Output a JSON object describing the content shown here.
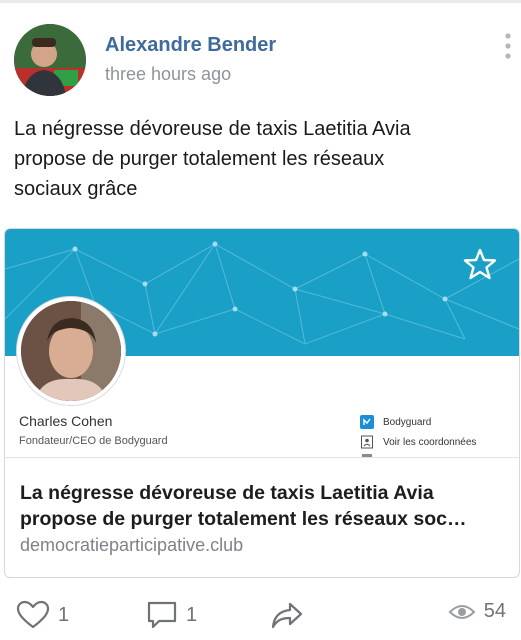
{
  "post": {
    "author": "Alexandre Bender",
    "time": "three hours ago",
    "text_lines": [
      "La négresse dévoreuse de taxis Laetitia Avia",
      "propose de purger totalement les réseaux",
      "sociaux grâce"
    ]
  },
  "link_card": {
    "preview": {
      "name": "Charles Cohen",
      "role": "Fondateur/CEO de Bodyguard",
      "company": "Bodyguard",
      "contact": "Voir les coordonnées"
    },
    "title_lines": [
      "La négresse dévoreuse de taxis Laetitia Avia",
      "propose de purger totalement les réseaux soc…"
    ],
    "domain": "democratieparticipative.club"
  },
  "actions": {
    "likes": "1",
    "comments": "1",
    "views": "54"
  },
  "colors": {
    "author": "#3f6a9c",
    "banner": "#1aa0c7",
    "icon_gray": "#6f7377"
  },
  "icons": [
    "more-vertical-icon",
    "star-icon",
    "heart-icon",
    "comment-icon",
    "share-icon",
    "eye-icon"
  ]
}
